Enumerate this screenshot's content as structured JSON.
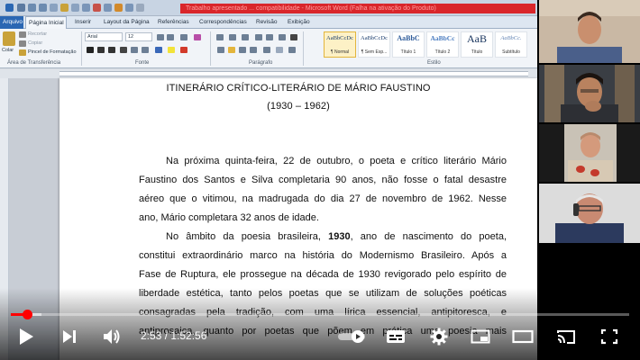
{
  "word": {
    "title_bar": "Trabalho apresentado ... compatibilidade - Microsoft Word (Falha na ativação do Produto)",
    "tabs": [
      "Arquivo",
      "Página Inicial",
      "Inserir",
      "Layout da Página",
      "Referências",
      "Correspondências",
      "Revisão",
      "Exibição"
    ],
    "clipboard": {
      "paste": "Colar",
      "cut": "Recortar",
      "copy": "Copiar",
      "format_painter": "Pincel de Formatação",
      "group": "Área de Transferência"
    },
    "font": {
      "name": "Arial",
      "size": "12",
      "group": "Fonte"
    },
    "paragraph_group": "Parágrafo",
    "styles": [
      {
        "sample": "AaBbCcDc",
        "name": "¶ Normal"
      },
      {
        "sample": "AaBbCcDc",
        "name": "¶ Sem Esp..."
      },
      {
        "sample": "AaBbC",
        "name": "Título 1"
      },
      {
        "sample": "AaBbCc",
        "name": "Título 2"
      },
      {
        "sample": "AaB",
        "name": "Título"
      },
      {
        "sample": "AaBbCc.",
        "name": "Subtítulo"
      }
    ],
    "styles_group": "Estilo"
  },
  "document": {
    "title": "ITINERÁRIO CRÍTICO-LITERÁRIO DE MÁRIO FAUSTINO",
    "subtitle": "(1930 – 1962)",
    "p1": [
      "Na próxima quinta-feira, 22 de outubro, o poeta e crítico literário Mário",
      "Faustino dos Santos e Silva completaria 90 anos, não fosse o fatal desastre",
      "aéreo que o vitimou, na madrugada do dia 27 de novembro de 1962.  Nesse",
      "ano, Mário completara 32 anos de idade."
    ],
    "p2_first_pre": "No âmbito da poesia brasileira, ",
    "p2_first_bold": "1930",
    "p2_first_post": ", ano de nascimento do poeta,",
    "p2": [
      "constitui extraordinário marco na história do Modernismo Brasileiro. Após a",
      "Fase de Ruptura, ele prossegue na década de 1930 revigorado pelo espírito de",
      "liberdade estética, tanto pelos poetas que se utilizam de soluções poéticas",
      "consagradas pela tradição, com uma lírica essencial, antipitoresca, e",
      "antiprosaica, quanto por poetas que põem em prática uma poesia mais"
    ]
  },
  "player": {
    "current_time": "2:53",
    "duration": "1:52:56",
    "time_display": "2:53 / 1:52:56",
    "played_fraction": 0.026,
    "buffered_fraction": 0.05,
    "colors": {
      "progress": "#ff0000",
      "word_file_tab": "#2b67b3",
      "title_bar": "#d9262b"
    }
  },
  "participants": [
    {
      "name": "participant-1",
      "bg": "#c9b8a4"
    },
    {
      "name": "participant-2",
      "bg": "#3a3e44"
    },
    {
      "name": "participant-3",
      "bg": "#1a1a1a"
    },
    {
      "name": "participant-4",
      "bg": "#dcdcdc"
    }
  ]
}
